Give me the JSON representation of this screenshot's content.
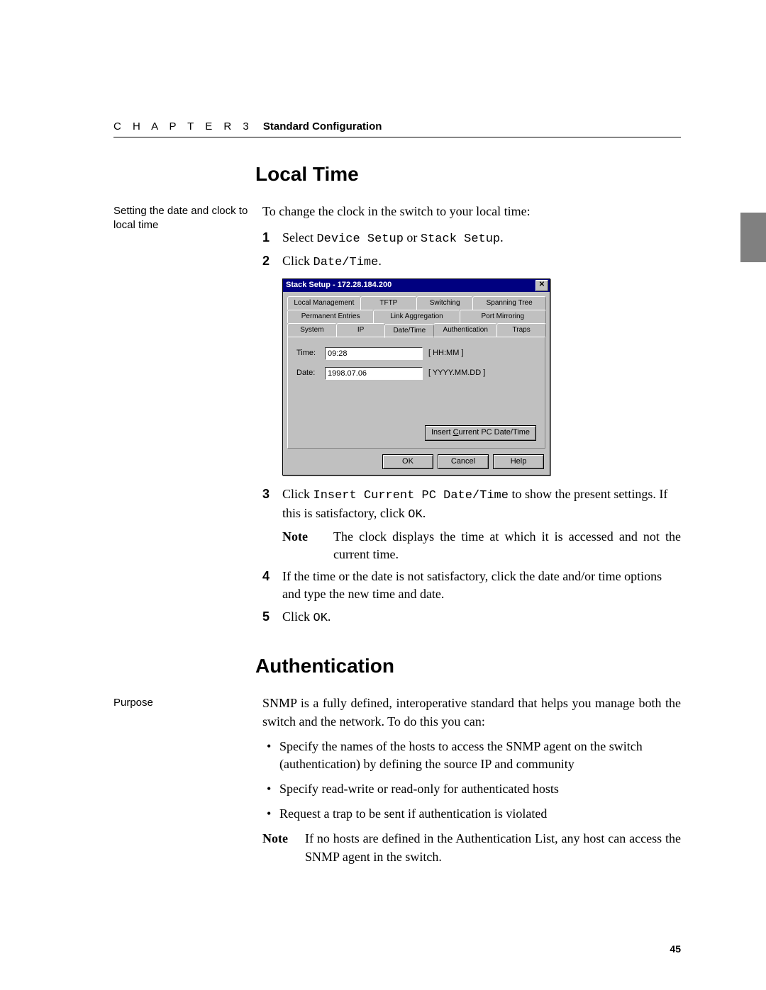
{
  "header": {
    "chapter": "C H A P T E R 3",
    "title": "Standard Configuration"
  },
  "page_number": "45",
  "section1": {
    "heading": "Local Time",
    "margin_note": "Setting the date and clock to local time",
    "intro": "To change the clock in the switch to your local time:",
    "step1_a": "Select ",
    "step1_code1": "Device Setup",
    "step1_b": " or ",
    "step1_code2": "Stack Setup",
    "step1_c": ".",
    "step2_a": "Click ",
    "step2_code": "Date/Time",
    "step2_b": ".",
    "step3_a": "Click ",
    "step3_code": "Insert Current PC Date/Time",
    "step3_b": " to show the present settings. If this is satisfactory, click ",
    "step3_code2": "OK",
    "step3_c": ".",
    "note_label": "Note",
    "note_body": "The clock displays the time at which it is accessed and not the current time.",
    "step4": "If the time or the date is not satisfactory, click the date and/or time options and type the new time and date.",
    "step5_a": "Click ",
    "step5_code": "OK",
    "step5_b": "."
  },
  "dialog": {
    "title": "Stack Setup - 172.28.184.200",
    "tabs_row1": [
      "Local Management",
      "TFTP",
      "Switching",
      "Spanning Tree"
    ],
    "tabs_row2": [
      "Permanent Entries",
      "Link Aggregation",
      "Port Mirroring"
    ],
    "tabs_row3": [
      "System",
      "IP",
      "Date/Time",
      "Authentication",
      "Traps"
    ],
    "active_tab": "Date/Time",
    "time_label": "Time:",
    "time_value": "09:28",
    "time_hint": "[ HH:MM ]",
    "date_label": "Date:",
    "date_value": "1998.07.06",
    "date_hint": "[ YYYY.MM.DD ]",
    "insert_btn_prefix": "Insert ",
    "insert_btn_u": "C",
    "insert_btn_suffix": "urrent PC Date/Time",
    "ok": "OK",
    "cancel": "Cancel",
    "help": "Help"
  },
  "section2": {
    "heading": "Authentication",
    "margin_note": "Purpose",
    "intro": "SNMP is a fully defined, interoperative standard that helps you manage both the switch and the network. To do this you can:",
    "bullet1": "Specify the names of the hosts to access the SNMP agent on the switch (authentication) by defining the source IP and community",
    "bullet2": "Specify read-write or read-only for authenticated hosts",
    "bullet3": "Request a trap to be sent if authentication is violated",
    "note_label": "Note",
    "note_body": "If no hosts are defined in the Authentication List, any host can access the SNMP agent in the switch."
  }
}
